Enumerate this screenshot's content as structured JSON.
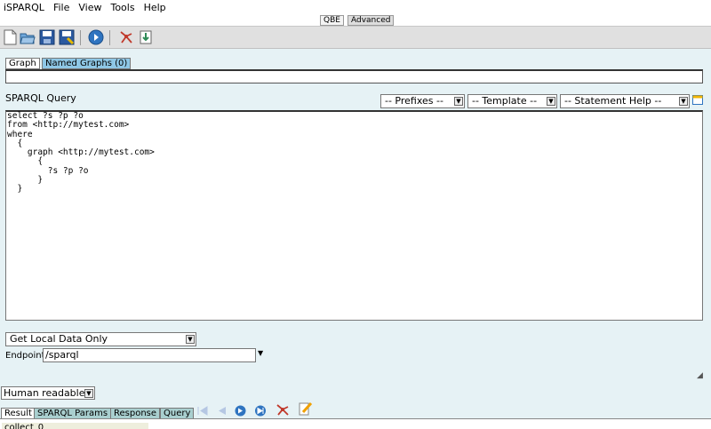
{
  "app_title": "iSPARQL",
  "menu": [
    "File",
    "View",
    "Tools",
    "Help"
  ],
  "modes": {
    "qbe": "QBE",
    "advanced": "Advanced"
  },
  "top_tabs": {
    "graph": "Graph",
    "named_graphs": "Named Graphs (0)"
  },
  "query_section": {
    "label": "SPARQL Query",
    "prefixes": "-- Prefixes --",
    "template": "-- Template --",
    "statement_help": "-- Statement Help --",
    "text": "select ?s ?p ?o\nfrom <http://mytest.com>\nwhere\n  {\n    graph <http://mytest.com>\n      {\n        ?s ?p ?o\n      }\n  }"
  },
  "data_source": {
    "selected": "Get Local Data Only"
  },
  "endpoint": {
    "label": "Endpoint",
    "value": "/sparql"
  },
  "format": {
    "selected": "Human readable"
  },
  "bottom_tabs": {
    "result": "Result",
    "params": "SPARQL Params",
    "response": "Response",
    "query": "Query"
  },
  "result_text": "collect_0"
}
